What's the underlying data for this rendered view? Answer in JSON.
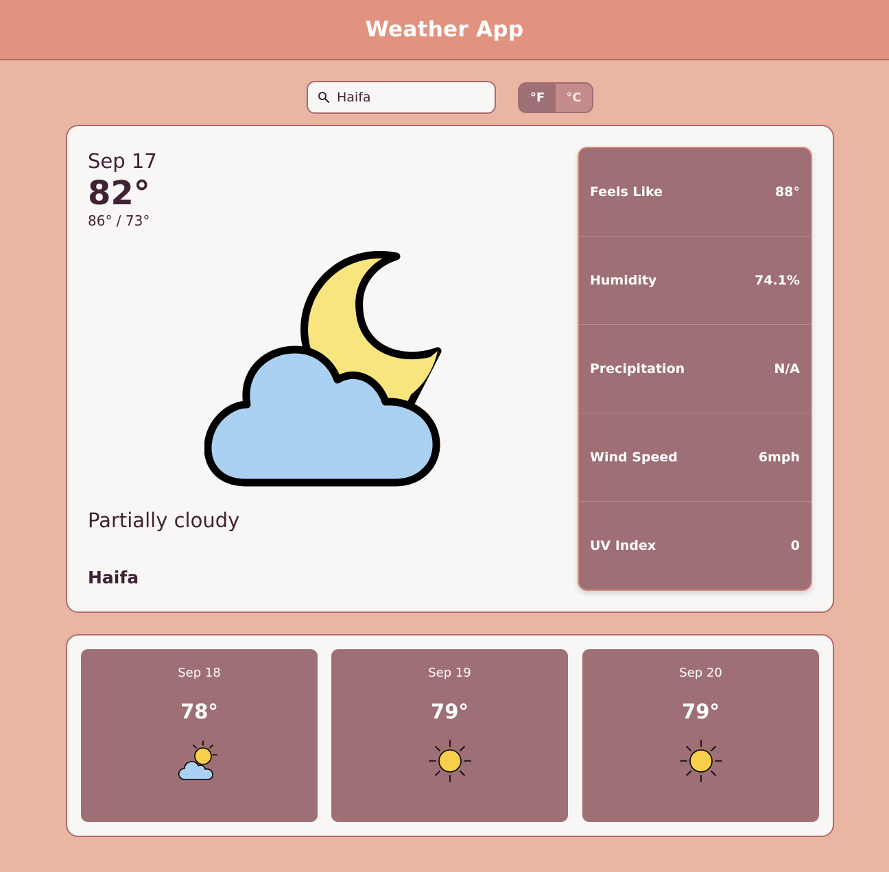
{
  "header": {
    "title": "Weather App"
  },
  "search": {
    "value": "Haifa",
    "icon": "search-icon"
  },
  "units": {
    "fahrenheit_label": "°F",
    "celsius_label": "°C",
    "selected": "°F"
  },
  "current": {
    "date": "Sep 17",
    "temp": "82°",
    "hilo": "86° / 73°",
    "condition": "Partially cloudy",
    "city": "Haifa",
    "icon": "partly-cloudy-night-icon"
  },
  "stats": [
    {
      "label": "Feels Like",
      "value": "88°"
    },
    {
      "label": "Humidity",
      "value": "74.1%"
    },
    {
      "label": "Precipitation",
      "value": "N/A"
    },
    {
      "label": "Wind Speed",
      "value": "6mph"
    },
    {
      "label": "UV Index",
      "value": "0"
    }
  ],
  "forecast": [
    {
      "date": "Sep 18",
      "temp": "78°",
      "icon": "partly-cloudy-day-icon"
    },
    {
      "date": "Sep 19",
      "temp": "79°",
      "icon": "sun-icon"
    },
    {
      "date": "Sep 20",
      "temp": "79°",
      "icon": "sun-icon"
    }
  ],
  "colors": {
    "background": "#eab6a4",
    "header": "#e0947f",
    "card": "#f9f7f6",
    "panel": "#9e6f74",
    "text": "#3f2234",
    "cloud": "#abd1f2",
    "moon": "#f9e57d",
    "sun": "#f7cf4b"
  }
}
